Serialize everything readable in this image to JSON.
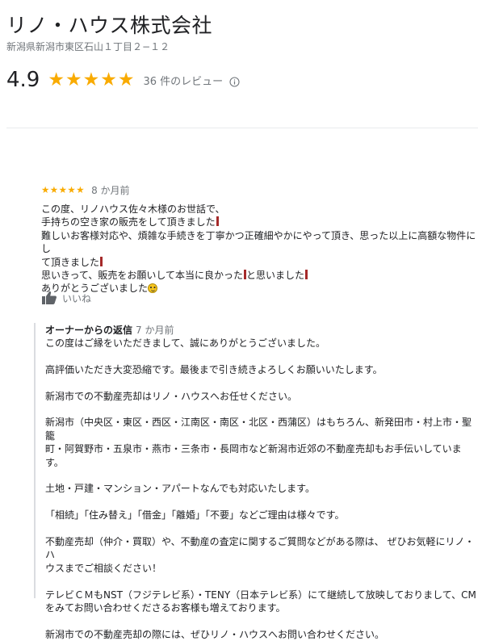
{
  "business": {
    "name": "リノ・ハウス株式会社",
    "address": "新潟県新潟市東区石山１丁目２−１２",
    "rating": "4.9",
    "stars": "★★★★★",
    "review_count": "36 件のレビュー",
    "info_icon": "info-circle-icon"
  },
  "review": {
    "stars": "★★★★★",
    "rating_value": 5,
    "date": "8 か月前",
    "lines": [
      "この度、リノハウス佐々木様のお世話で、",
      "手持ちの空き家の販売をして頂きました",
      "難しいお客様対応や、煩雑な手続きを丁寧かつ正確細やかにやって頂き、思った以上に高額な物件にし",
      "て頂きました",
      "思いきって、販売をお願いして本当に良かった",
      "と思いました",
      "ありがとうございました"
    ],
    "like_label": "いいね",
    "like_icon": "thumbs-up-icon",
    "emoji": "smiling-face-icon"
  },
  "reply": {
    "owner_label": "オーナーからの返信",
    "date": "7 か月前",
    "lines": [
      "この度はご縁をいただきまして、誠にありがとうございました。",
      "",
      "高評価いただき大変恐縮です。最後まで引き続きよろしくお願いいたします。",
      "",
      "新潟市での不動産売却はリノ・ハウスへお任せください。",
      "",
      "新潟市（中央区・東区・西区・江南区・南区・北区・西蒲区）はもちろん、新発田市・村上市・聖籠",
      "町・阿賀野市・五泉市・燕市・三条市・長岡市など新潟市近郊の不動産売却もお手伝いしています。",
      "",
      "土地・戸建・マンション・アパートなんでも対応いたします。",
      "",
      "「相続」「住み替え」「借金」「離婚」「不要」などご理由は様々です。",
      "",
      "不動産売却（仲介・買取）や、不動産の査定に関するご質問などがある際は、 ぜひお気軽にリノ・ハ",
      "ウスまでご相談ください！",
      "",
      "テレビＣＭもNST（フジテレビ系）・TENY（日本テレビ系）にて継続して放映しておりまして、CM",
      "をみてお問い合わせくださるお客様も増えております。",
      "",
      "新潟市での不動産売却の際には、ぜひリノ・ハウスへお問い合わせください。"
    ]
  }
}
